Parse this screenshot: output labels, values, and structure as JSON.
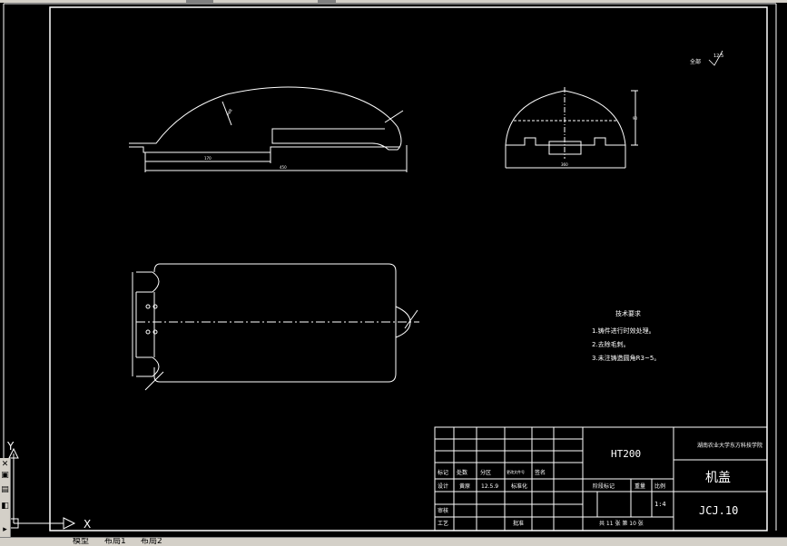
{
  "ucs": {
    "x_label": "X",
    "y_label": "Y"
  },
  "surface_note": {
    "label": "全部",
    "value": "12.5"
  },
  "tech_req": {
    "title": "技术要求",
    "items": [
      "1.铸件进行时效处理。",
      "2.去除毛刺。",
      "3.未注铸造圆角R3~5。"
    ]
  },
  "title_block": {
    "material": "HT200",
    "school": "湖南农业大学东方科技学院",
    "part_name": "机盖",
    "drawing_no": "JCJ.10",
    "scale": "1:4",
    "scale_label": "比例",
    "weight_label": "重量",
    "stage_label": "阶段标记",
    "sheets": "共 11 张 第 10 张",
    "row_labels": [
      "标记",
      "处数",
      "分区",
      "更改文件号",
      "签名"
    ],
    "designer_label": "设计",
    "designer": "黄原",
    "date": "12.5.9",
    "standard_label": "标准化",
    "review_label": "审核",
    "process_label": "工艺",
    "approve_label": "批准"
  },
  "dims": {
    "front_len_total": "450",
    "front_len_part": "170",
    "front_radius": "R88",
    "side_width": "360",
    "side_height": "90"
  },
  "tabbar": {
    "tabs": [
      "模型",
      "布局1",
      "布局2"
    ]
  },
  "colors": {
    "background": "#000000",
    "lines": "#ffffff",
    "panel": "#d4d0c8"
  }
}
